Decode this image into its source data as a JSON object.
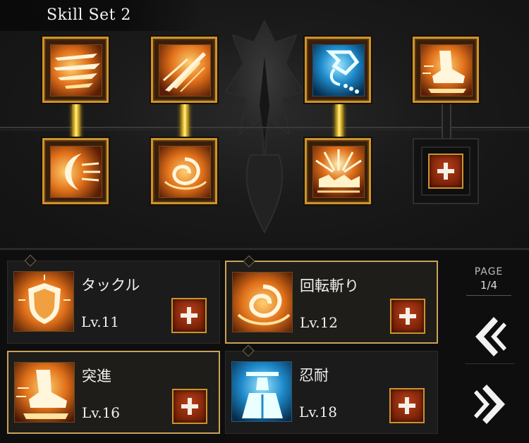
{
  "skill_set": {
    "title": "Skill Set 2"
  },
  "tree": {
    "top_row": [
      {
        "icon": "dash-slash-icon",
        "color": "orange"
      },
      {
        "icon": "spear-thrust-icon",
        "color": "orange"
      },
      {
        "icon": "grapple-hook-icon",
        "color": "blue"
      },
      {
        "icon": "charging-foot-icon",
        "color": "orange"
      }
    ],
    "bottom_row": [
      {
        "icon": "wind-crescent-icon",
        "color": "orange"
      },
      {
        "icon": "whirlwind-icon",
        "color": "orange"
      },
      {
        "icon": "ground-burst-icon",
        "color": "orange"
      },
      {
        "icon": "add-slot-icon",
        "empty": true
      }
    ]
  },
  "skills": [
    {
      "name": "タックル",
      "level": "Lv.11",
      "icon": "shield-icon",
      "selected": false
    },
    {
      "name": "回転斬り",
      "level": "Lv.12",
      "icon": "whirlwind-icon",
      "selected": true
    },
    {
      "name": "突進",
      "level": "Lv.16",
      "icon": "charging-foot-icon",
      "selected": true
    },
    {
      "name": "忍耐",
      "level": "Lv.18",
      "icon": "endurance-figure-icon",
      "selected": false
    }
  ],
  "pager": {
    "label": "PAGE",
    "value": "1/4"
  },
  "colors": {
    "gold": "#c9952e",
    "connector": "#f6d24a",
    "plus_red": "#a8351a",
    "icon_orange": "#e0701a",
    "icon_blue": "#1e8acb"
  }
}
